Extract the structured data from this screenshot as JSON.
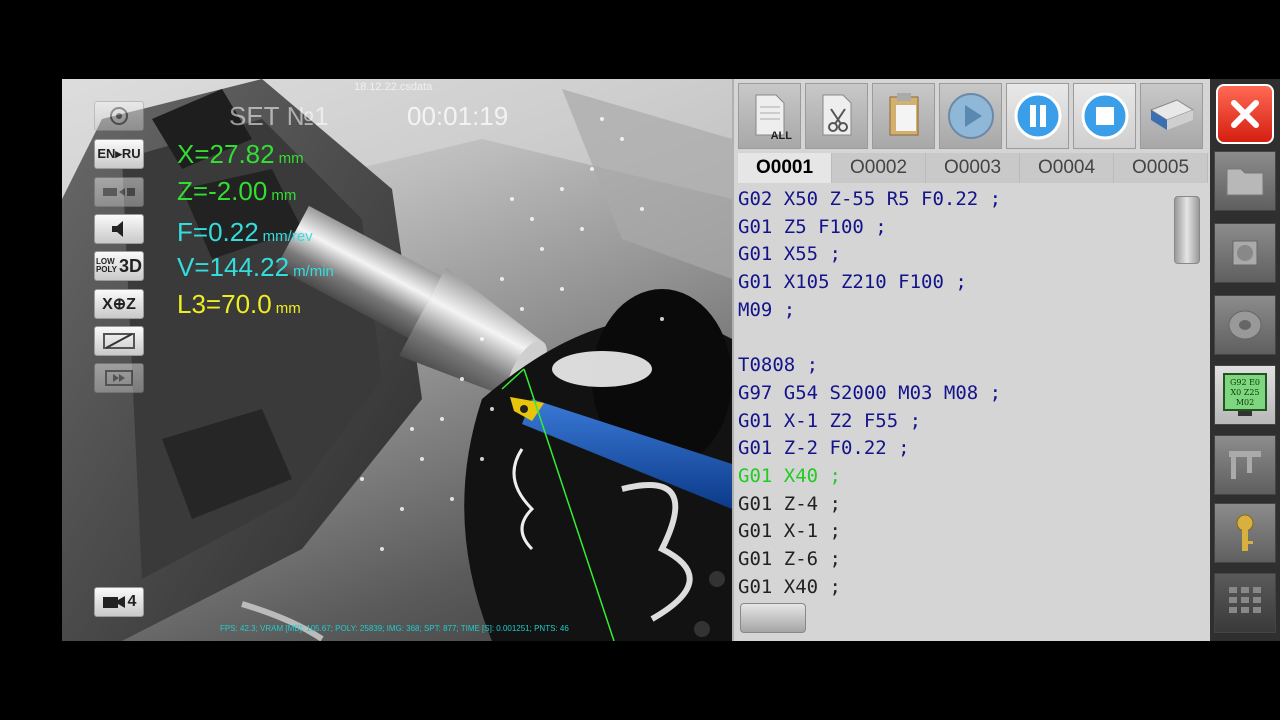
{
  "filename": "18.12.22.csdata",
  "viewport": {
    "set_label": "SET №1",
    "timer": "00:01:19",
    "readouts": {
      "x": {
        "text": "X=27.82",
        "unit": "mm"
      },
      "z": {
        "text": "Z=-2.00",
        "unit": "mm"
      },
      "f": {
        "text": "F=0.22",
        "unit": "mm/rev"
      },
      "v": {
        "text": "V=144.22",
        "unit": "m/min"
      },
      "l3": {
        "text": "L3=70.0",
        "unit": "mm"
      }
    },
    "buttons": {
      "lang": "EN▸RU",
      "low": "LOW",
      "poly": "POLY",
      "three_d": "3D",
      "axis": "X⊕Z"
    },
    "camera": {
      "number": "4"
    },
    "stats": "FPS: 42.3; VRAM [MB]: 105.67; POLY: 25839; IMG: 368; SPT: 877; TIME [S]: 0.001251; PNTS: 46"
  },
  "code_panel": {
    "toolbar": {
      "all_label": "ALL"
    },
    "tabs": [
      "O0001",
      "O0002",
      "O0003",
      "O0004",
      "O0005"
    ],
    "active_tab": 0,
    "lines": [
      "G02 X50 Z-55 R5 F0.22 ;",
      "G01 Z5 F100 ;",
      "G01 X55 ;",
      "G01 X105 Z210 F100 ;",
      "M09 ;",
      "",
      "T0808 ;",
      "G97 G54 S2000 M03 M08 ;",
      "G01 X-1 Z2 F55 ;",
      "G01 Z-2 F0.22 ;",
      "G01 X40 ;",
      "G01 Z-4 ;",
      "G01 X-1 ;",
      "G01 Z-6 ;",
      "G01 X40 ;"
    ],
    "current_line": 10
  },
  "sidebar": {
    "program_icon_lines": [
      "G92 E0",
      "X0 Z25",
      "M02"
    ]
  },
  "colors": {
    "readout_green": "#33dd33",
    "readout_cyan": "#33dddd",
    "readout_yellow": "#eeee22",
    "code_blue": "#14148a",
    "current_line_green": "#22cc22",
    "close_red": "#e83a28"
  }
}
